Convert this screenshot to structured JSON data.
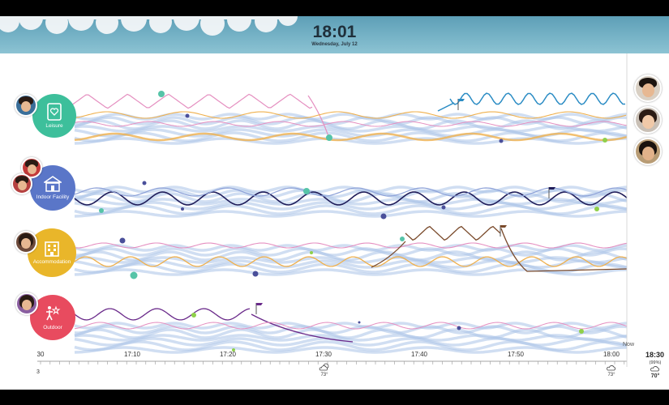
{
  "header": {
    "time": "18:01",
    "date": "Wednesday, July 12"
  },
  "categories": [
    {
      "name": "Leisure",
      "icon": "heart-card-icon",
      "color": "#3dbf9b"
    },
    {
      "name": "Indoor Facility",
      "icon": "building-icon",
      "color": "#5a76c8"
    },
    {
      "name": "Accommodation",
      "icon": "hotel-icon",
      "color": "#e9b62a"
    },
    {
      "name": "Outdoor",
      "icon": "outdoor-activity-icon",
      "color": "#e84b5f"
    }
  ],
  "timeline": {
    "ticks": [
      "30",
      "17:10",
      "17:20",
      "17:30",
      "17:40",
      "17:50",
      "18:00"
    ],
    "now_label": "Now",
    "end_time": "18:30",
    "weather_1": {
      "temp": "73°",
      "icon": "partly-cloudy-icon"
    },
    "weather_2": {
      "temp": "73°",
      "icon": "cloud-icon"
    },
    "right_weather": {
      "humidity": "(99%)",
      "temp": "70°",
      "icon": "cloud-icon"
    },
    "left_label": "3"
  },
  "colors": {
    "header": "#6ea9bd",
    "band": "#a9c3e8",
    "pink": "#e58fc0",
    "orange": "#efb04d",
    "blue": "#2b8cc4",
    "navy": "#1f1c59",
    "brown": "#7a4a2b",
    "purple": "#6a2a8a"
  }
}
